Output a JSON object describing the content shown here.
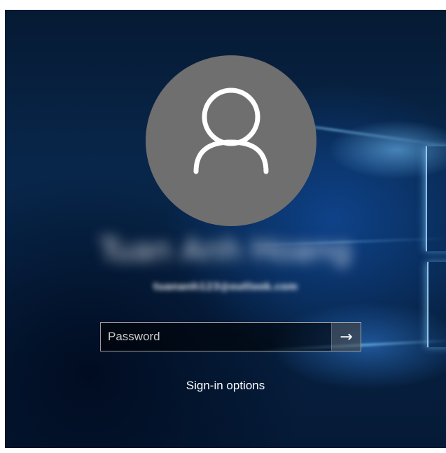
{
  "user": {
    "display_name": "Tuan Anh Hoang",
    "email": "tuananh123@outlook.com",
    "avatar_icon": "user-silhouette-icon",
    "avatar_color": "#6f6f6f"
  },
  "password": {
    "placeholder": "Password",
    "value": "",
    "submit_icon": "arrow-right-icon",
    "submit_glyph": "→"
  },
  "signin_options": {
    "label": "Sign-in options"
  }
}
